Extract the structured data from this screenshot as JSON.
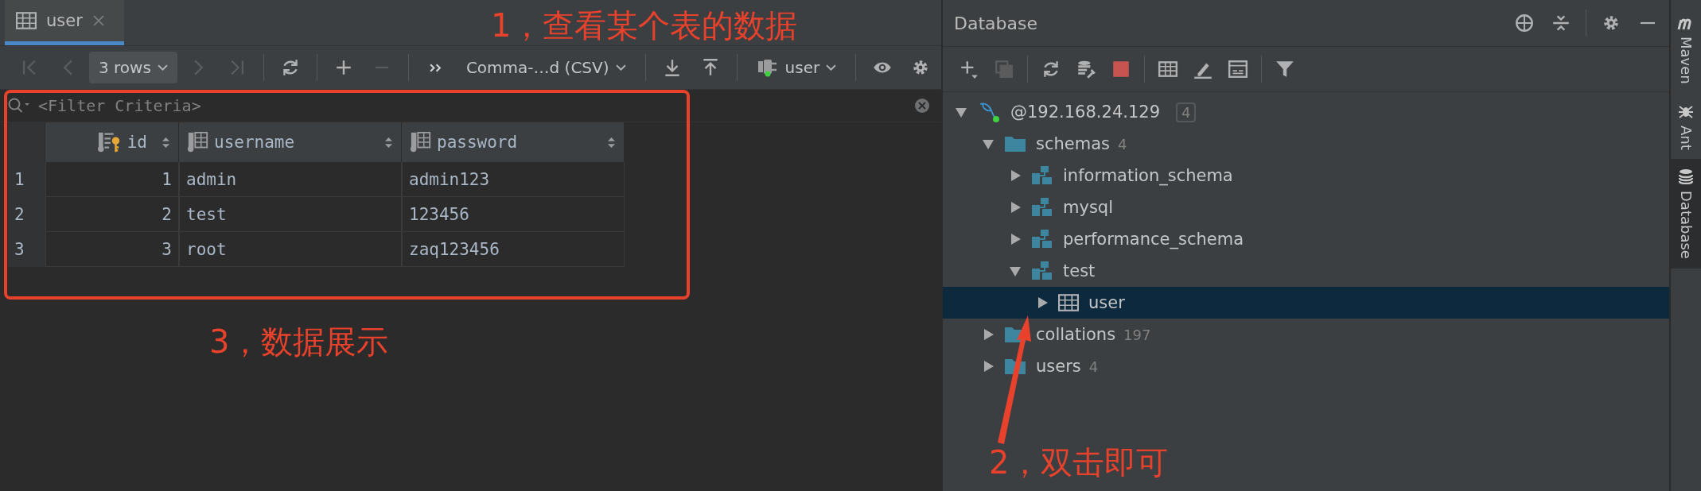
{
  "editor": {
    "tab": {
      "label": "user",
      "selected": true
    },
    "toolbar": [
      {
        "kind": "first",
        "disabled": true
      },
      {
        "kind": "prev",
        "disabled": true
      },
      {
        "kind": "combo",
        "label": "3 rows"
      },
      {
        "kind": "next",
        "disabled": true
      },
      {
        "kind": "last",
        "disabled": true
      },
      {
        "kind": "separator"
      },
      {
        "kind": "refresh",
        "disabled": false
      },
      {
        "kind": "separator"
      },
      {
        "kind": "add",
        "disabled": false
      },
      {
        "kind": "remove",
        "disabled": true
      },
      {
        "kind": "separator"
      },
      {
        "kind": "more",
        "disabled": false
      },
      {
        "kind": "dropdown",
        "label": "Comma-…d (CSV)"
      },
      {
        "kind": "separator"
      },
      {
        "kind": "download",
        "disabled": false
      },
      {
        "kind": "upload",
        "disabled": false
      },
      {
        "kind": "separator"
      },
      {
        "kind": "session",
        "label": "user"
      },
      {
        "kind": "separator"
      },
      {
        "kind": "view",
        "disabled": false
      },
      {
        "kind": "settings",
        "disabled": false
      }
    ],
    "filter": {
      "placeholder": "<Filter Criteria>"
    },
    "table": {
      "columns": [
        {
          "name": "id",
          "kind": "primary_key"
        },
        {
          "name": "username",
          "kind": "column"
        },
        {
          "name": "password",
          "kind": "column"
        }
      ],
      "rows": [
        {
          "number": "1",
          "cells": [
            "1",
            "admin",
            "admin123"
          ]
        },
        {
          "number": "2",
          "cells": [
            "2",
            "test",
            "123456"
          ]
        },
        {
          "number": "3",
          "cells": [
            "3",
            "root",
            "zaq123456"
          ]
        }
      ]
    }
  },
  "database": {
    "title": "Database",
    "header_actions": [
      {
        "kind": "locate"
      },
      {
        "kind": "collapse"
      },
      {
        "kind": "separator"
      },
      {
        "kind": "settings"
      },
      {
        "kind": "minimize"
      }
    ],
    "toolbar": [
      {
        "kind": "add",
        "disabled": false
      },
      {
        "kind": "duplicate",
        "disabled": true
      },
      {
        "kind": "separator"
      },
      {
        "kind": "refresh",
        "disabled": false
      },
      {
        "kind": "properties",
        "disabled": false
      },
      {
        "kind": "stop",
        "disabled": false
      },
      {
        "kind": "separator"
      },
      {
        "kind": "table",
        "disabled": false
      },
      {
        "kind": "edit",
        "disabled": false
      },
      {
        "kind": "console",
        "disabled": false
      },
      {
        "kind": "separator"
      },
      {
        "kind": "filter",
        "disabled": false
      }
    ],
    "tree": [
      {
        "label": "@192.168.24.129",
        "kind": "datasource",
        "count": "4",
        "expanded": true,
        "selected": false,
        "children": [
          {
            "label": "schemas",
            "kind": "folder",
            "count": "4",
            "expanded": true,
            "selected": false,
            "children": [
              {
                "label": "information_schema",
                "kind": "schema",
                "expanded": false,
                "selected": false
              },
              {
                "label": "mysql",
                "kind": "schema",
                "expanded": false,
                "selected": false
              },
              {
                "label": "performance_schema",
                "kind": "schema",
                "expanded": false,
                "selected": false
              },
              {
                "label": "test",
                "kind": "schema",
                "expanded": true,
                "selected": false,
                "children": [
                  {
                    "label": "user",
                    "kind": "table",
                    "expanded": false,
                    "selected": true
                  }
                ]
              }
            ]
          },
          {
            "label": "collations",
            "kind": "folder",
            "count": "197",
            "expanded": false,
            "selected": false
          },
          {
            "label": "users",
            "kind": "folder",
            "count": "4",
            "expanded": false,
            "selected": false
          }
        ]
      }
    ]
  },
  "tool_stripe": [
    {
      "label": "Maven",
      "kind": "maven",
      "selected": false
    },
    {
      "label": "Ant",
      "kind": "ant",
      "selected": false
    },
    {
      "label": "Database",
      "kind": "database",
      "selected": true
    }
  ],
  "annotations": [
    {
      "text": "1，查看某个表的数据"
    },
    {
      "text": "2，双击即可"
    },
    {
      "text": "3，数据展示"
    }
  ]
}
